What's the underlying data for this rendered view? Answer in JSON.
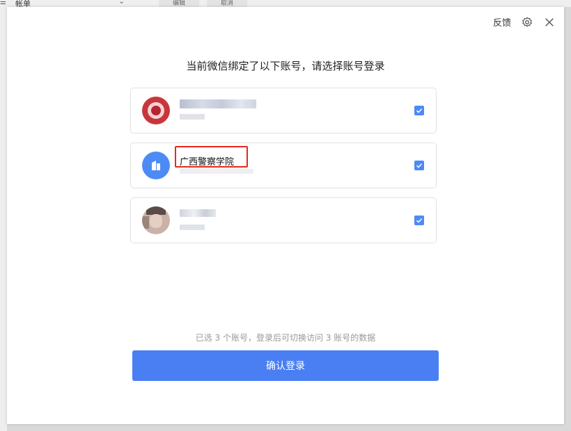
{
  "background": {
    "menu_label": "帐单",
    "button_left": "编辑",
    "button_right": "取消"
  },
  "dialog": {
    "feedback_label": "反馈",
    "title": "当前微信绑定了以下账号，请选择账号登录",
    "accounts": [
      {
        "name": "",
        "subtitle": "",
        "checked": true,
        "avatar_color": "#c9353b"
      },
      {
        "name": "广西警察学院",
        "subtitle": "",
        "checked": true,
        "avatar_color": "#4c8bf5"
      },
      {
        "name": "",
        "subtitle": "",
        "checked": true,
        "avatar_color": "#c9b3a8"
      }
    ],
    "summary": "已选 3 个账号，登录后可切换访问 3 账号的数据",
    "confirm_label": "确认登录"
  },
  "colors": {
    "accent": "#4a7ff3",
    "highlight": "#e5281f"
  }
}
